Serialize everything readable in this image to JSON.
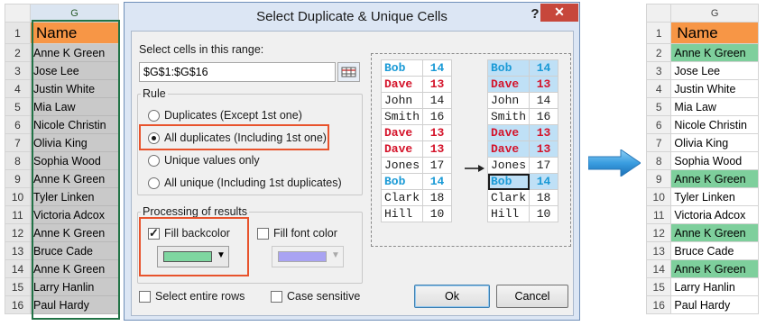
{
  "left_sheet": {
    "column": "G",
    "header": "Name",
    "rows": [
      {
        "num": "1",
        "value": "Name"
      },
      {
        "num": "2",
        "value": "Anne K Green"
      },
      {
        "num": "3",
        "value": "Jose Lee"
      },
      {
        "num": "4",
        "value": "Justin White"
      },
      {
        "num": "5",
        "value": "Mia Law"
      },
      {
        "num": "6",
        "value": "Nicole Christin"
      },
      {
        "num": "7",
        "value": "Olivia King"
      },
      {
        "num": "8",
        "value": "Sophia Wood"
      },
      {
        "num": "9",
        "value": "Anne K Green"
      },
      {
        "num": "10",
        "value": "Tyler Linken"
      },
      {
        "num": "11",
        "value": "Victoria  Adcox"
      },
      {
        "num": "12",
        "value": "Anne K Green"
      },
      {
        "num": "13",
        "value": "Bruce Cade"
      },
      {
        "num": "14",
        "value": "Anne K Green"
      },
      {
        "num": "15",
        "value": "Larry Hanlin"
      },
      {
        "num": "16",
        "value": "Paul Hardy"
      }
    ]
  },
  "right_sheet": {
    "column": "G",
    "highlighted_rows": [
      "2",
      "9",
      "12",
      "14"
    ],
    "highlight_color": "#7ecf9c",
    "header_color": "#f79646"
  },
  "dialog": {
    "title": "Select Duplicate & Unique Cells",
    "help_label": "?",
    "close_label": "✕",
    "range_label": "Select cells in this range:",
    "range_value": "$G$1:$G$16",
    "rule_label": "Rule",
    "rules": [
      {
        "label": "Duplicates (Except 1st one)",
        "checked": false
      },
      {
        "label": "All duplicates (Including 1st one)",
        "checked": true
      },
      {
        "label": "Unique values only",
        "checked": false
      },
      {
        "label": "All unique (Including 1st duplicates)",
        "checked": false
      }
    ],
    "processing_label": "Processing of results",
    "fill_backcolor_label": "Fill backcolor",
    "fill_backcolor_checked": true,
    "fill_backcolor_color": "#7ed6a0",
    "fill_font_color_label": "Fill font color",
    "fill_font_color_checked": false,
    "fill_font_color_color": "#a9a3f2",
    "select_entire_rows_label": "Select entire rows",
    "case_sensitive_label": "Case sensitive",
    "ok_label": "Ok",
    "cancel_label": "Cancel"
  },
  "preview": {
    "before": [
      {
        "name": "Bob",
        "num": "14",
        "style": "blue"
      },
      {
        "name": "Dave",
        "num": "13",
        "style": "red"
      },
      {
        "name": "John",
        "num": "14",
        "style": "black"
      },
      {
        "name": "Smith",
        "num": "16",
        "style": "black"
      },
      {
        "name": "Dave",
        "num": "13",
        "style": "red"
      },
      {
        "name": "Dave",
        "num": "13",
        "style": "red"
      },
      {
        "name": "Jones",
        "num": "17",
        "style": "black"
      },
      {
        "name": "Bob",
        "num": "14",
        "style": "blue"
      },
      {
        "name": "Clark",
        "num": "18",
        "style": "black"
      },
      {
        "name": "Hill",
        "num": "10",
        "style": "black"
      }
    ],
    "after": [
      {
        "name": "Bob",
        "num": "14",
        "style": "blue",
        "hl": true
      },
      {
        "name": "Dave",
        "num": "13",
        "style": "red",
        "hl": true
      },
      {
        "name": "John",
        "num": "14",
        "style": "black",
        "hl": false
      },
      {
        "name": "Smith",
        "num": "16",
        "style": "black",
        "hl": false
      },
      {
        "name": "Dave",
        "num": "13",
        "style": "red",
        "hl": true
      },
      {
        "name": "Dave",
        "num": "13",
        "style": "red",
        "hl": true
      },
      {
        "name": "Jones",
        "num": "17",
        "style": "black",
        "hl": false
      },
      {
        "name": "Bob",
        "num": "14",
        "style": "blue",
        "hl": true,
        "sel": true
      },
      {
        "name": "Clark",
        "num": "18",
        "style": "black",
        "hl": false
      },
      {
        "name": "Hill",
        "num": "10",
        "style": "black",
        "hl": false
      }
    ]
  }
}
